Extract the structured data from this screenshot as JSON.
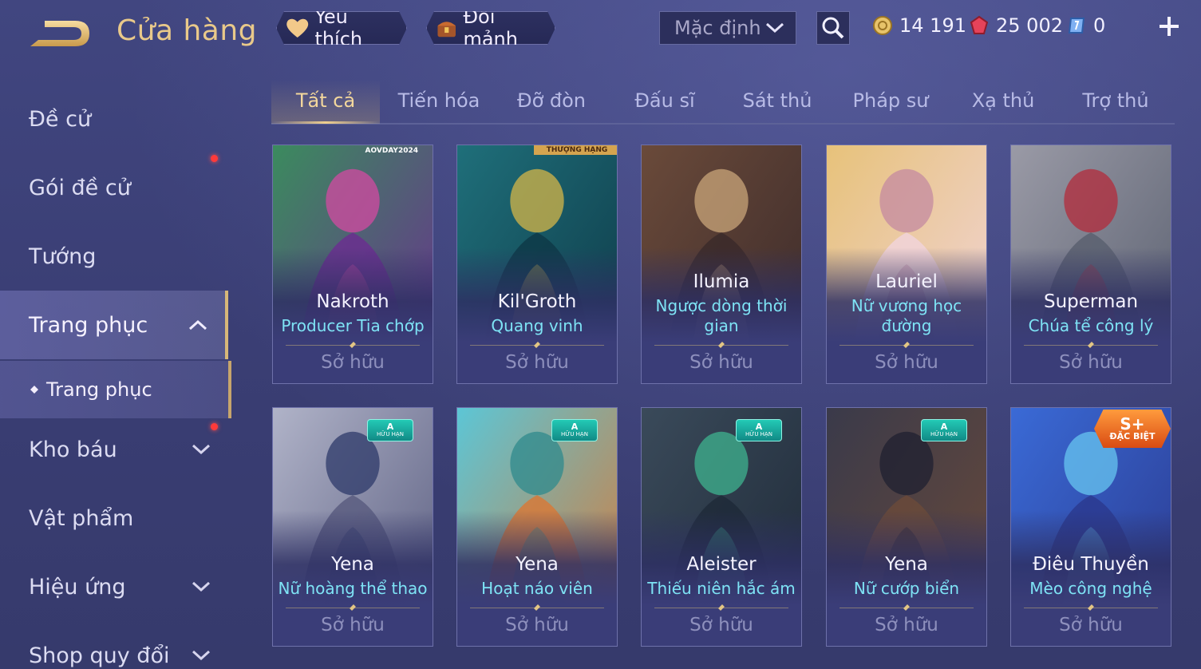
{
  "header": {
    "title": "Cửa hàng",
    "favorites_label": "Yêu thích",
    "shards_label": "Đổi mảnh",
    "sort_value": "Mặc định",
    "currency": {
      "gold": "14 191",
      "ruby": "25 002",
      "voucher": "0"
    }
  },
  "sidebar": {
    "items": [
      {
        "label": "Đề cử"
      },
      {
        "label": "Gói đề cử"
      },
      {
        "label": "Tướng"
      },
      {
        "label": "Trang phục"
      },
      {
        "label": "Kho báu"
      },
      {
        "label": "Vật phẩm"
      },
      {
        "label": "Hiệu ứng"
      },
      {
        "label": "Shop quy đổi"
      }
    ],
    "sub_item": "Trang phục"
  },
  "tabs": [
    "Tất cả",
    "Tiến hóa",
    "Đỡ đòn",
    "Đấu sĩ",
    "Sát thủ",
    "Pháp sư",
    "Xạ thủ",
    "Trợ thủ"
  ],
  "owned_label": "Sở hữu",
  "cards": [
    {
      "hero": "Nakroth",
      "skin": "Producer Tia chớp",
      "corner_text": "AOVDAY2024",
      "palette": [
        "#3b8b5e",
        "#6a2f8f",
        "#d34aa1"
      ]
    },
    {
      "hero": "Kil'Groth",
      "skin": "Quang vinh",
      "ribbon": "THƯỢNG HẠNG",
      "palette": [
        "#1f6f7a",
        "#0e3a48",
        "#d4b548"
      ]
    },
    {
      "hero": "Ilumia",
      "skin": "Ngược dòng thời gian",
      "palette": [
        "#6a4a3a",
        "#3b2a2a",
        "#c9a57a"
      ]
    },
    {
      "hero": "Lauriel",
      "skin": "Nữ vương học đường",
      "palette": [
        "#e7c27a",
        "#f1d4d9",
        "#c48aa0"
      ]
    },
    {
      "hero": "Superman",
      "skin": "Chúa tể công lý",
      "palette": [
        "#9a9aa6",
        "#5a6070",
        "#b32b3b"
      ]
    },
    {
      "hero": "Yena",
      "skin": "Nữ hoàng thể thao",
      "tag": "A",
      "tag_sub": "HỮU HẠN",
      "palette": [
        "#b0b3c8",
        "#5a5d80",
        "#2d3a6a"
      ]
    },
    {
      "hero": "Yena",
      "skin": "Hoạt náo viên",
      "tag": "A",
      "tag_sub": "HỮU HẠN",
      "palette": [
        "#5cc6d6",
        "#d67a3a",
        "#2f8a8c"
      ]
    },
    {
      "hero": "Aleister",
      "skin": "Thiếu niên hắc ám",
      "tag": "A",
      "tag_sub": "HỮU HẠN",
      "palette": [
        "#3a4a5a",
        "#1f2a38",
        "#3fb38f"
      ]
    },
    {
      "hero": "Yena",
      "skin": "Nữ cướp biển",
      "tag": "A",
      "tag_sub": "HỮU HẠN",
      "palette": [
        "#3a3a4a",
        "#6a4a3a",
        "#1f2030"
      ]
    },
    {
      "hero": "Điêu Thuyền",
      "skin": "Mèo công nghệ",
      "tag": "S+",
      "tag_sub": "ĐẶC BIỆT",
      "palette": [
        "#3a6ad6",
        "#2b3a8f",
        "#67c6f0"
      ]
    }
  ]
}
